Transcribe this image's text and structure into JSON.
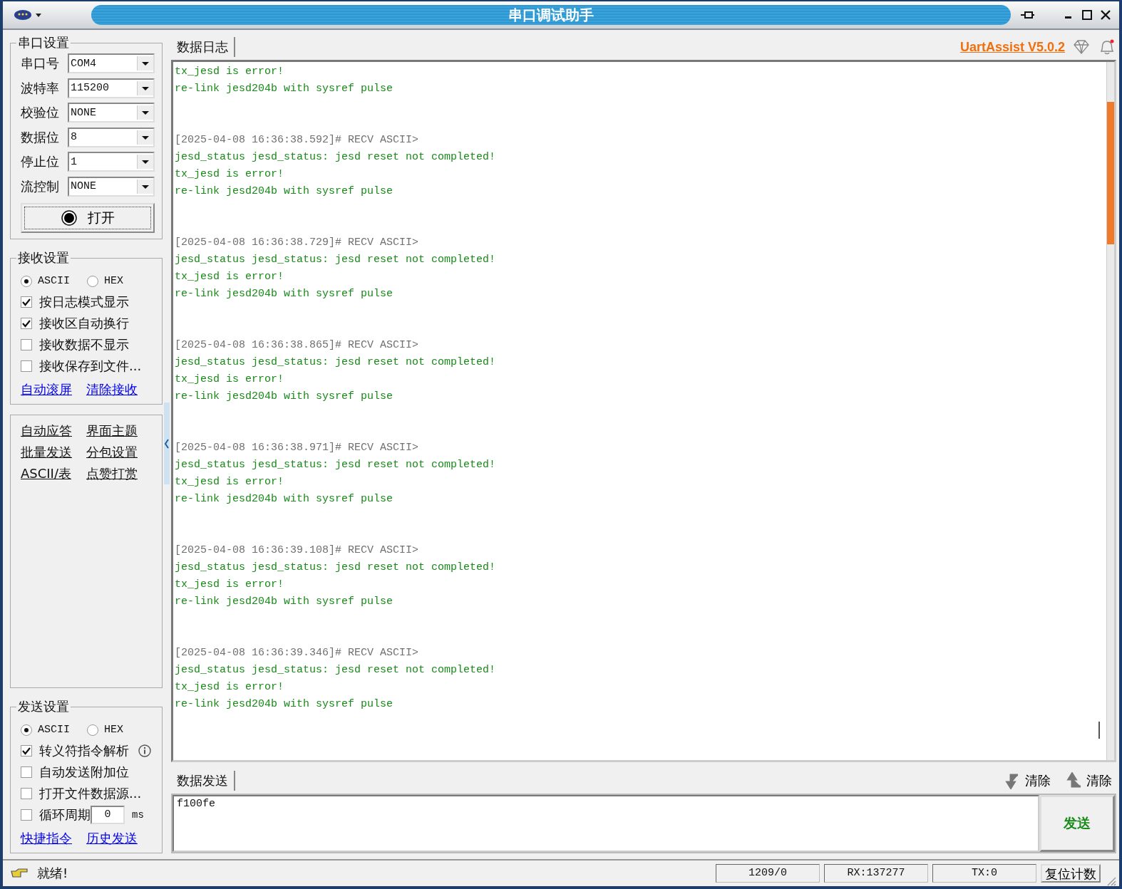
{
  "window": {
    "title": "串口调试助手"
  },
  "serial_settings": {
    "title": "串口设置",
    "fields": [
      {
        "label": "串口号",
        "value": "COM4"
      },
      {
        "label": "波特率",
        "value": "115200"
      },
      {
        "label": "校验位",
        "value": "NONE"
      },
      {
        "label": "数据位",
        "value": "8"
      },
      {
        "label": "停止位",
        "value": "1"
      },
      {
        "label": "流控制",
        "value": "NONE"
      }
    ],
    "open_button": "打开"
  },
  "receive_settings": {
    "title": "接收设置",
    "modes": [
      {
        "label": "ASCII",
        "selected": true
      },
      {
        "label": "HEX",
        "selected": false
      }
    ],
    "options": [
      {
        "label": "按日志模式显示",
        "checked": true
      },
      {
        "label": "接收区自动换行",
        "checked": true
      },
      {
        "label": "接收数据不显示",
        "checked": false
      },
      {
        "label": "接收保存到文件...",
        "checked": false
      }
    ],
    "links": [
      "自动滚屏",
      "清除接收"
    ]
  },
  "tools": {
    "links": [
      "自动应答",
      "界面主题",
      "批量发送",
      "分包设置",
      "ASCII/表",
      "点赞打赏"
    ]
  },
  "send_settings": {
    "title": "发送设置",
    "modes": [
      {
        "label": "ASCII",
        "selected": true
      },
      {
        "label": "HEX",
        "selected": false
      }
    ],
    "options": [
      {
        "kind": "info",
        "label": "转义符指令解析",
        "checked": true
      },
      {
        "kind": "plain",
        "label": "自动发送附加位",
        "checked": false
      },
      {
        "kind": "plain",
        "label": "打开文件数据源...",
        "checked": false
      },
      {
        "kind": "period",
        "label": "循环周期",
        "checked": false,
        "value": "0",
        "unit": "ms"
      }
    ],
    "links": [
      "快捷指令",
      "历史发送"
    ]
  },
  "log": {
    "tab": "数据日志",
    "version_link": "UartAssist V5.0.2",
    "blocks": [
      {
        "lines": [
          "tx_jesd is error!",
          "re-link jesd204b with sysref pulse"
        ]
      },
      {
        "header": "[2025-04-08 16:36:38.592]# RECV ASCII>",
        "lines": [
          "jesd_status jesd_status: jesd reset not completed!",
          "tx_jesd is error!",
          "re-link jesd204b with sysref pulse"
        ]
      },
      {
        "header": "[2025-04-08 16:36:38.729]# RECV ASCII>",
        "lines": [
          "jesd_status jesd_status: jesd reset not completed!",
          "tx_jesd is error!",
          "re-link jesd204b with sysref pulse"
        ]
      },
      {
        "header": "[2025-04-08 16:36:38.865]# RECV ASCII>",
        "lines": [
          "jesd_status jesd_status: jesd reset not completed!",
          "tx_jesd is error!",
          "re-link jesd204b with sysref pulse"
        ]
      },
      {
        "header": "[2025-04-08 16:36:38.971]# RECV ASCII>",
        "lines": [
          "jesd_status jesd_status: jesd reset not completed!",
          "tx_jesd is error!",
          "re-link jesd204b with sysref pulse"
        ]
      },
      {
        "header": "[2025-04-08 16:36:39.108]# RECV ASCII>",
        "lines": [
          "jesd_status jesd_status: jesd reset not completed!",
          "tx_jesd is error!",
          "re-link jesd204b with sysref pulse"
        ]
      },
      {
        "header": "[2025-04-08 16:36:39.346]# RECV ASCII>",
        "lines": [
          "jesd_status jesd_status: jesd reset not completed!",
          "tx_jesd is error!",
          "re-link jesd204b with sysref pulse"
        ]
      }
    ]
  },
  "send": {
    "tab": "数据发送",
    "clear_buttons": [
      "清除",
      "清除"
    ],
    "input_value": "f100fe",
    "send_button": "发送"
  },
  "status_bar": {
    "message": "就绪!",
    "counters": [
      "1209/0",
      "RX:137277",
      "TX:0"
    ],
    "reset_button": "复位计数"
  }
}
